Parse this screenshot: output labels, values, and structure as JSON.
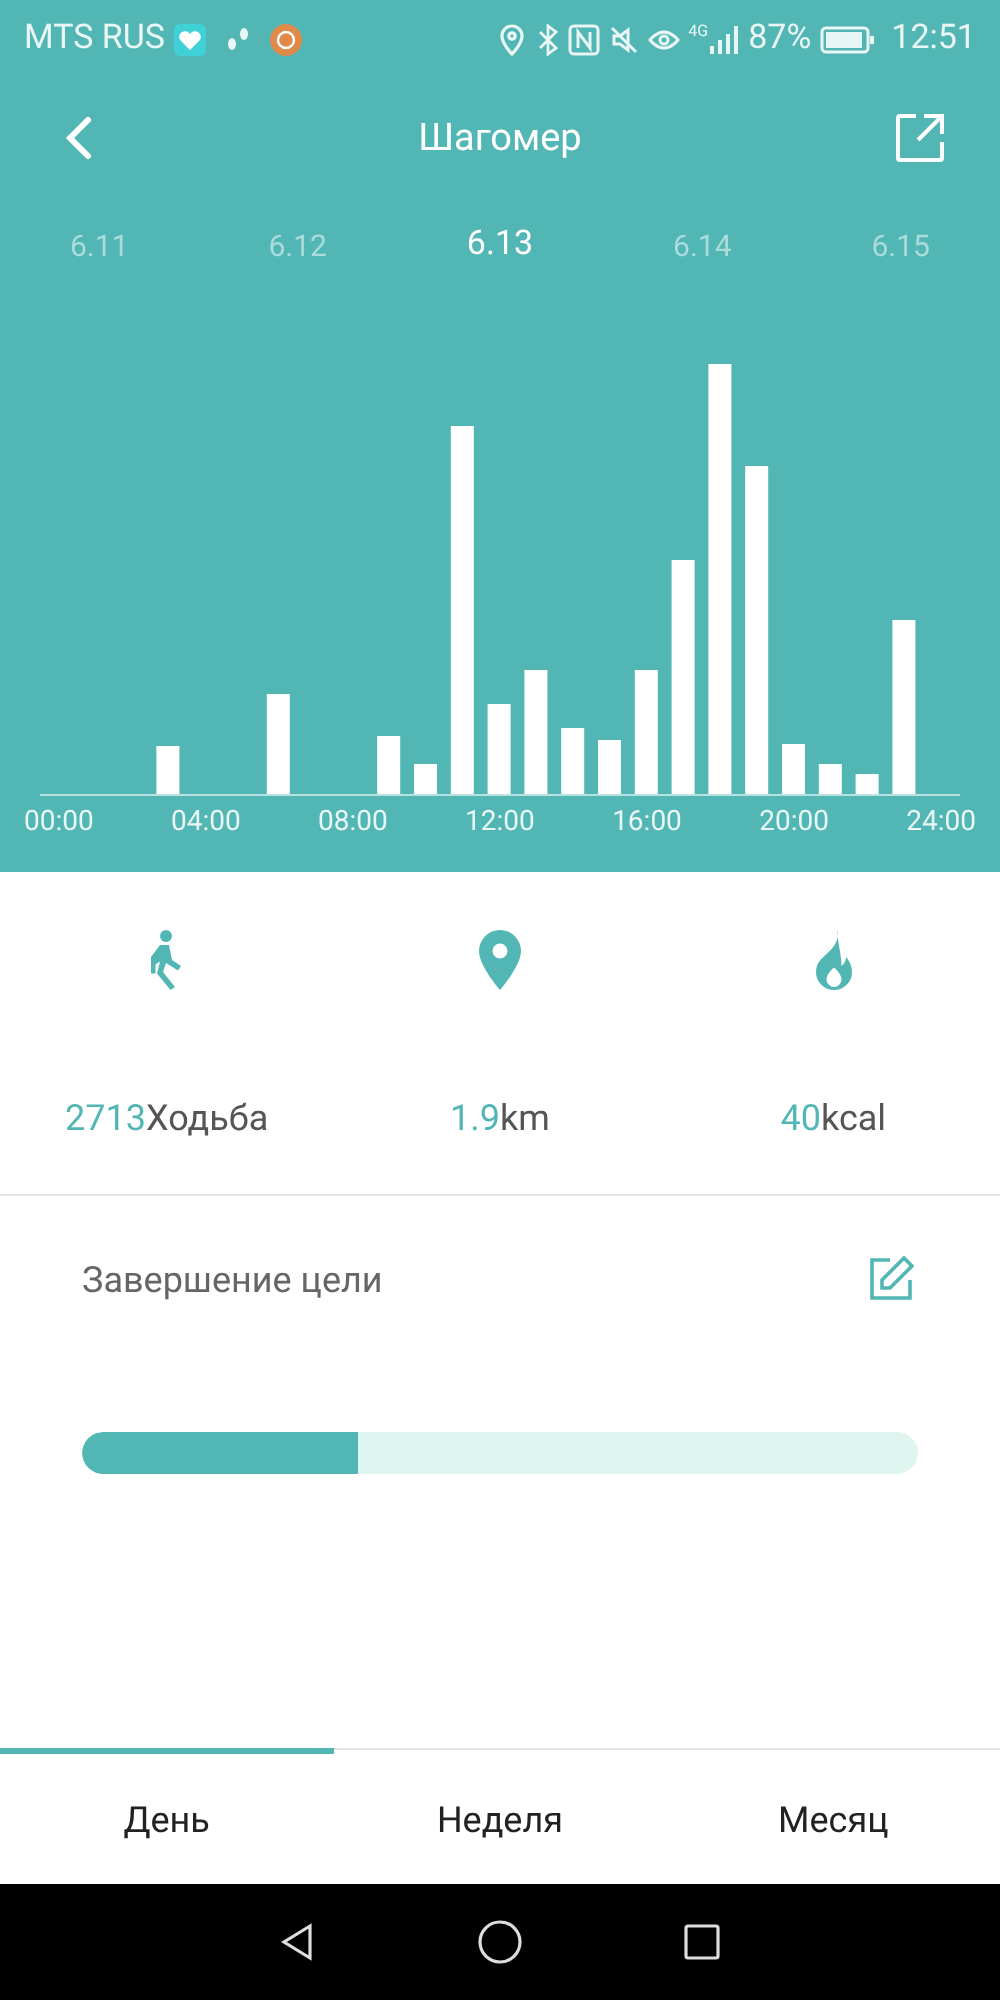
{
  "status_bar": {
    "carrier": "MTS RUS",
    "network": "4G",
    "battery": "87%",
    "time": "12:51"
  },
  "header": {
    "title": "Шагомер"
  },
  "dates": [
    {
      "label": "6.11",
      "selected": false
    },
    {
      "label": "6.12",
      "selected": false
    },
    {
      "label": "6.13",
      "selected": true
    },
    {
      "label": "6.14",
      "selected": false
    },
    {
      "label": "6.15",
      "selected": false
    }
  ],
  "chart": {
    "x_labels": [
      "00:00",
      "04:00",
      "08:00",
      "12:00",
      "16:00",
      "20:00",
      "24:00"
    ]
  },
  "stats": [
    {
      "kind": "steps",
      "value": "2713",
      "unit": "Ходьба"
    },
    {
      "kind": "distance",
      "value": "1.9",
      "unit": "km"
    },
    {
      "kind": "calories",
      "value": "40",
      "unit": "kcal"
    }
  ],
  "goal": {
    "title": "Завершение цели",
    "level": 0.33
  },
  "tabs": [
    {
      "label": "День",
      "selected": true
    },
    {
      "label": "Неделя",
      "selected": false
    },
    {
      "label": "Месяц",
      "selected": false
    }
  ]
}
